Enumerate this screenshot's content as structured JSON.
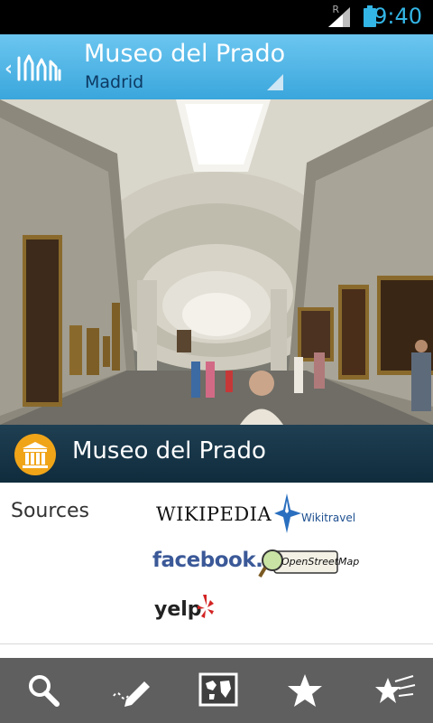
{
  "status_bar": {
    "time": "9:40",
    "network_label": "R",
    "icons": [
      "signal-icon",
      "battery-icon"
    ],
    "accent_color": "#33b5e5"
  },
  "action_bar": {
    "title": "Museo del Prado",
    "subtitle": "Madrid",
    "icons": [
      "back-chevron-icon",
      "app-logo-icon",
      "dropdown-indicator-icon"
    ],
    "colors": {
      "bar_top": "#6cc6f0",
      "bar_bottom": "#3aa6dc",
      "subtitle": "#0d3a63"
    }
  },
  "place": {
    "name": "Museo del Prado",
    "icon": "museum-icon",
    "icon_color": "#f0a418"
  },
  "sources": {
    "label": "Sources",
    "items": [
      {
        "name": "wikipedia",
        "text": "WIKIPEDIA"
      },
      {
        "name": "wikitravel",
        "text": "Wikitravel"
      },
      {
        "name": "facebook",
        "text": "facebook."
      },
      {
        "name": "openstreetmap",
        "text": "OpenStreetMap"
      },
      {
        "name": "yelp",
        "text": "yelp"
      }
    ]
  },
  "bottom_bar": {
    "tabs": [
      {
        "name": "search",
        "icon": "search-icon"
      },
      {
        "name": "notes",
        "icon": "pencil-icon"
      },
      {
        "name": "map",
        "icon": "map-icon"
      },
      {
        "name": "favorites",
        "icon": "star-icon"
      },
      {
        "name": "favorites-list",
        "icon": "shooting-star-icon"
      }
    ]
  }
}
